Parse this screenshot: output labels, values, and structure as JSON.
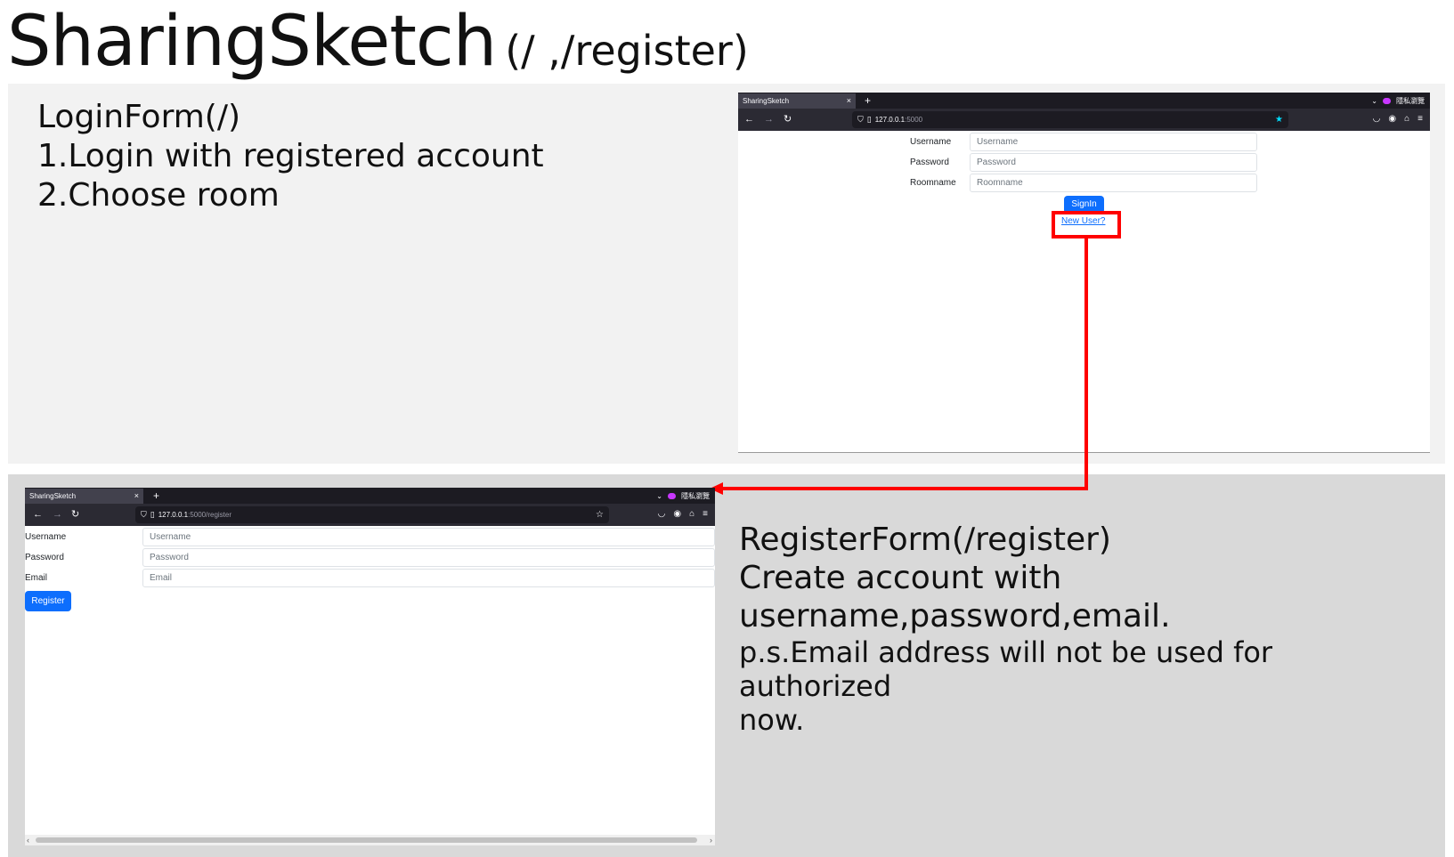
{
  "slide": {
    "title": "SharingSketch",
    "subtitle": "(/ ,/register)"
  },
  "login_desc": {
    "line1": "LoginForm(/)",
    "line2": "1.Login with registered account",
    "line3": "2.Choose room"
  },
  "register_desc": {
    "line1": "RegisterForm(/register)",
    "line2": "Create account with",
    "line3": "username,password,email.",
    "line4": "p.s.Email address will not be used for authorized",
    "line5": "now."
  },
  "login_browser": {
    "tab_title": "SharingSketch",
    "tab_close": "×",
    "new_tab": "+",
    "private_label": "隱私瀏覽",
    "url_host": "127.0.0.1",
    "url_rest": ":5000",
    "form": {
      "username_label": "Username",
      "username_placeholder": "Username",
      "password_label": "Password",
      "password_placeholder": "Password",
      "roomname_label": "Roomname",
      "roomname_placeholder": "Roomname",
      "signin_label": "SignIn",
      "new_user_link": "New User?"
    }
  },
  "register_browser": {
    "tab_title": "SharingSketch",
    "tab_close": "×",
    "new_tab": "+",
    "private_label": "隱私瀏覽",
    "url_host": "127.0.0.1",
    "url_rest": ":5000/register",
    "form": {
      "username_label": "Username",
      "username_placeholder": "Username",
      "password_label": "Password",
      "password_placeholder": "Password",
      "email_label": "Email",
      "email_placeholder": "Email",
      "register_label": "Register"
    }
  },
  "icons": {
    "back": "←",
    "forward": "→",
    "reload": "↻",
    "shield": "⛉",
    "page": "▯",
    "star_filled": "★",
    "star_outline": "☆",
    "pocket": "◡",
    "account": "◉",
    "extensions": "⌂",
    "menu": "≡",
    "chevron_down": "⌄",
    "scroll_left": "‹",
    "scroll_right": "›"
  },
  "colors": {
    "accent_blue": "#0d6efd",
    "highlight_red": "#ff0000",
    "panel_top_bg": "#f2f2f2",
    "panel_bottom_bg": "#d9d9d9",
    "browser_dark": "#1c1b22",
    "favorite_star": "#00ddff"
  }
}
